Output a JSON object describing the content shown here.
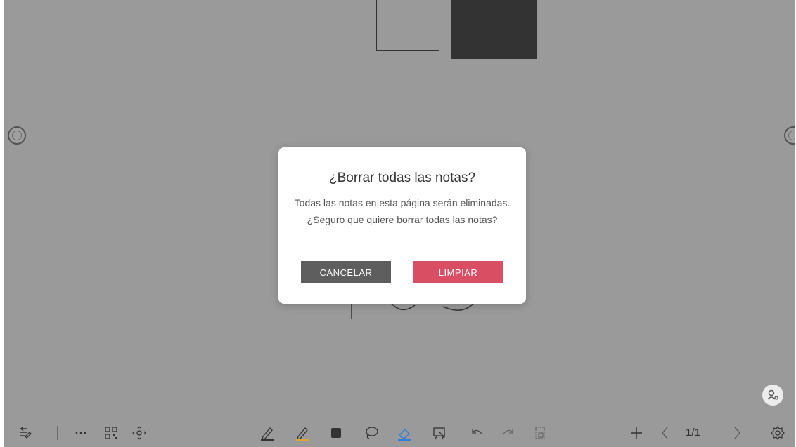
{
  "dialog": {
    "title": "¿Borrar todas las notas?",
    "message": "Todas las notas en esta página serán eliminadas. ¿Seguro que quiere borrar todas las notas?",
    "cancel_label": "CANCELAR",
    "confirm_label": "LIMPIAR"
  },
  "toolbar": {
    "page_counter": "1/1",
    "left_tools": [
      "exit-annotation-icon",
      "more-icon",
      "qr-code-icon",
      "move-icon"
    ],
    "center_tools": [
      "pen-icon",
      "highlighter-icon",
      "shape-icon",
      "lasso-icon",
      "eraser-icon",
      "screen-capture-icon",
      "undo-icon",
      "redo-icon",
      "page-thumbnails-icon"
    ],
    "right_tools": [
      "add-page-icon",
      "prev-page-icon",
      "next-page-icon",
      "settings-icon"
    ],
    "active_tool": "eraser-icon"
  },
  "colors": {
    "overlay": "#808080",
    "cancel_button": "#5e5e5e",
    "confirm_button": "#d94e63",
    "pen_underline": "#333333",
    "highlighter_underline": "#d8a93a",
    "active_tool": "#2f7fd8"
  }
}
